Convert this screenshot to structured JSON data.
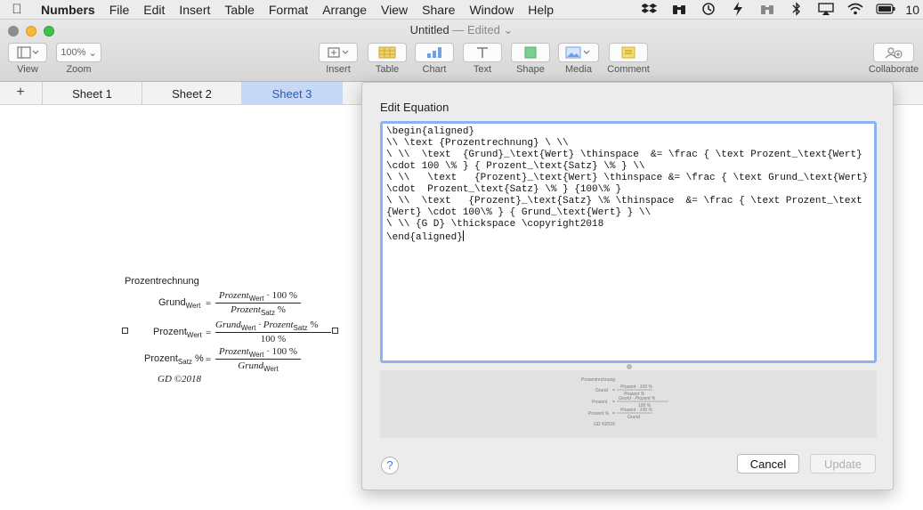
{
  "menubar": {
    "app": "Numbers",
    "items": [
      "File",
      "Edit",
      "Insert",
      "Table",
      "Format",
      "Arrange",
      "View",
      "Share",
      "Window",
      "Help"
    ],
    "clock": "10",
    "status_icons": [
      "dropbox-icon",
      "binoculars-icon",
      "time-machine-icon",
      "bolt-icon",
      "binoculars2-icon",
      "bluetooth-icon",
      "airplay-icon",
      "wifi-icon",
      "battery-icon"
    ]
  },
  "window": {
    "title": "Untitled",
    "edited": "— Edited"
  },
  "toolbar": {
    "view_label": "View",
    "zoom_value": "100%",
    "zoom_label": "Zoom",
    "insert_label": "Insert",
    "table_label": "Table",
    "chart_label": "Chart",
    "text_label": "Text",
    "shape_label": "Shape",
    "media_label": "Media",
    "comment_label": "Comment",
    "collaborate_label": "Collaborate"
  },
  "sheets": {
    "add": "+",
    "tabs": [
      "Sheet 1",
      "Sheet 2",
      "Sheet 3"
    ],
    "active": "Sheet 3"
  },
  "equation": {
    "heading": "Prozentrechnung",
    "lhs1": "Grund",
    "lhs1_sub": "Wert",
    "num1": "Prozent",
    "num1_sub": "Wert",
    "num1_tail": "· 100 %",
    "den1": "Prozent",
    "den1_sub": "Satz",
    "den1_tail": "%",
    "lhs2": "Prozent",
    "lhs2_sub": "Wert",
    "num2a": "Grund",
    "num2a_sub": "Wert",
    "num2_mid": "· Prozent",
    "num2b_sub": "Satz",
    "num2_tail": "%",
    "den2": "100 %",
    "lhs3": "Prozent",
    "lhs3_sub": "Satz",
    "lhs3_tail": "%",
    "num3": "Prozent",
    "num3_sub": "Wert",
    "num3_tail": "· 100 %",
    "den3": "Grund",
    "den3_sub": "Wert",
    "footer": "GD ©2018",
    "equals": "="
  },
  "dialog": {
    "title": "Edit Equation",
    "latex": "\\begin{aligned}\n\\\\ \\text {Prozentrechnung} \\ \\\\\n\\ \\\\  \\text  {Grund}_\\text{Wert} \\thinspace  &= \\frac { \\text Prozent_\\text{Wert} \\cdot 100 \\% } { Prozent_\\text{Satz} \\% } \\\\\n\\ \\\\   \\text   {Prozent}_\\text{Wert} \\thinspace &= \\frac { \\text Grund_\\text{Wert} \\cdot  Prozent_\\text{Satz} \\% } {100\\% }\n\\ \\\\  \\text   {Prozent}_\\text{Satz} \\% \\thinspace  &= \\frac { \\text Prozent_\\text{Wert} \\cdot 100\\% } { Grund_\\text{Wert} } \\\\\n\\ \\\\ {G D} \\thickspace \\copyright2018\n\\end{aligned}",
    "help": "?",
    "cancel": "Cancel",
    "update": "Update"
  }
}
